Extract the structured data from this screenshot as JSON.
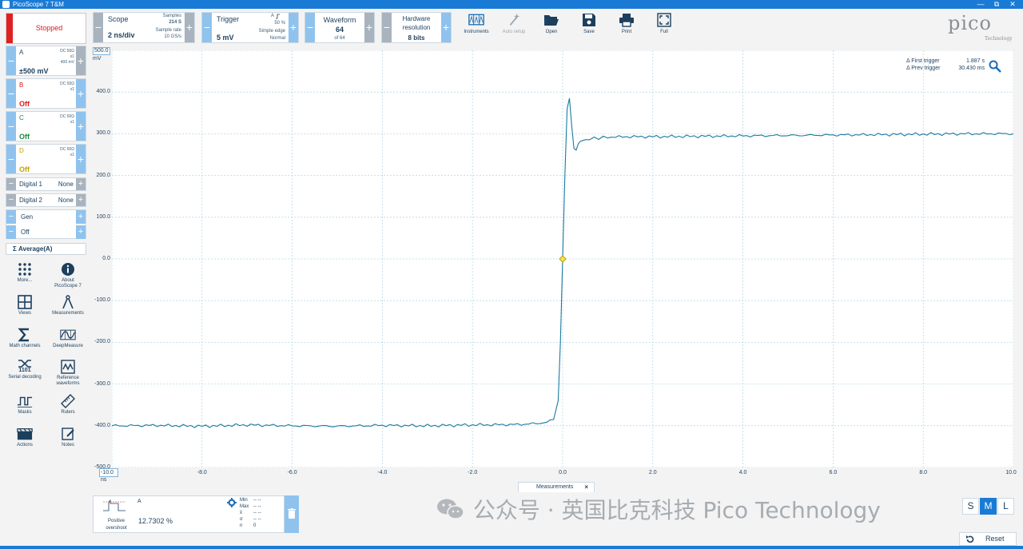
{
  "window": {
    "title": "PicoScope 7 T&M",
    "controls": [
      "—",
      "⧉",
      "✕"
    ]
  },
  "run": {
    "state_label": "Stopped"
  },
  "scope": {
    "title": "Scope",
    "value": "2 ns/div",
    "samples_label": "Samples",
    "samples_value": "214 S",
    "rate_label": "Sample rate",
    "rate_value": "10 GS/s"
  },
  "trigger": {
    "title": "Trigger",
    "value": "5 mV",
    "channel": "A",
    "percent": "50 %",
    "type": "Simple edge",
    "mode": "Normal"
  },
  "waveform": {
    "title": "Waveform",
    "value": "64",
    "sub": "of 64"
  },
  "hwres": {
    "title": "Hardware resolution",
    "value": "8 bits"
  },
  "tools": {
    "instruments": "Instruments",
    "auto_setup": "Auto setup",
    "open": "Open",
    "save": "Save",
    "print": "Print",
    "full": "Full"
  },
  "logo": {
    "main": "pico",
    "sub": "Technology"
  },
  "channels": [
    {
      "name": "A",
      "coupling": "DC 50Ω",
      "probe": "x1",
      "extra": "400 mV",
      "value": "±500 mV",
      "color": "#1c3f5e"
    },
    {
      "name": "B",
      "coupling": "DC 50Ω",
      "probe": "x1",
      "value": "Off",
      "color": "#d61d1d"
    },
    {
      "name": "C",
      "coupling": "DC 50Ω",
      "probe": "x1",
      "value": "Off",
      "color": "#1c8a3a"
    },
    {
      "name": "D",
      "coupling": "DC 50Ω",
      "probe": "x1",
      "value": "Off",
      "color": "#c8a000"
    }
  ],
  "digital": [
    {
      "name": "Digital 1",
      "state": "None"
    },
    {
      "name": "Digital 2",
      "state": "None"
    }
  ],
  "gen": {
    "name": "Gen",
    "state": "Off"
  },
  "math": {
    "symbol": "Σ",
    "label": "Average(A)"
  },
  "side": {
    "more": "More...",
    "about": "About PicoScope 7",
    "views": "Views",
    "measurements": "Measurements",
    "math": "Math channels",
    "deep": "DeepMeasure",
    "serial": "Serial decoding",
    "serial_num": "1101",
    "ref": "Reference waveforms",
    "masks": "Masks",
    "rulers": "Rulers",
    "actions": "Actions",
    "notes": "Notes"
  },
  "chart_data": {
    "type": "line",
    "xlabel": "ns",
    "ylabel": "mV",
    "xlim": [
      -10.0,
      10.0
    ],
    "ylim": [
      -500.0,
      500.0
    ],
    "x_ticks": [
      "-10.0",
      "-8.0",
      "-6.0",
      "-4.0",
      "-2.0",
      "0.0",
      "2.0",
      "4.0",
      "6.0",
      "8.0",
      "10.0"
    ],
    "y_ticks": [
      "500.0",
      "400.0",
      "300.0",
      "200.0",
      "100.0",
      "0.0",
      "-100.0",
      "-200.0",
      "-300.0",
      "-400.0",
      "-500.0"
    ],
    "grid": true,
    "series": [
      {
        "name": "A",
        "color": "#1b7aa0",
        "x": [
          -10.0,
          -9.0,
          -8.0,
          -7.0,
          -6.0,
          -5.0,
          -4.0,
          -3.0,
          -2.0,
          -1.0,
          -0.5,
          -0.2,
          -0.1,
          -0.05,
          0.0,
          0.05,
          0.1,
          0.15,
          0.2,
          0.25,
          0.3,
          0.35,
          0.4,
          0.5,
          0.6,
          0.8,
          1.0,
          1.5,
          2.0,
          3.0,
          4.0,
          5.0,
          6.0,
          7.0,
          8.0,
          9.0,
          10.0
        ],
        "y": [
          -400,
          -399,
          -401,
          -398,
          -400,
          -401,
          -399,
          -400,
          -398,
          -397,
          -394,
          -385,
          -340,
          -200,
          0,
          200,
          360,
          385,
          320,
          265,
          262,
          275,
          282,
          285,
          288,
          290,
          292,
          293,
          293,
          294,
          295,
          296,
          297,
          298,
          299,
          300,
          300
        ]
      }
    ]
  },
  "trigger_info": {
    "first_label": "Δ First trigger",
    "first_value": "1.887 s",
    "prev_label": "Δ Prev trigger",
    "prev_value": "30.430 ms"
  },
  "measurements": {
    "tab_label": "Measurements",
    "close": "×",
    "channel": "A",
    "name": "Positive overshoot",
    "value": "12.7302 %",
    "stats": [
      {
        "k": "Min",
        "v": "-- --"
      },
      {
        "k": "Max",
        "v": "-- --"
      },
      {
        "k": "x̄",
        "v": "-- --"
      },
      {
        "k": "σ",
        "v": "-- --"
      },
      {
        "k": "n",
        "v": "0"
      }
    ]
  },
  "watermark": "公众号 · 英国比克科技 Pico Technology",
  "size_buttons": [
    "S",
    "M",
    "L"
  ],
  "reset_label": "Reset"
}
